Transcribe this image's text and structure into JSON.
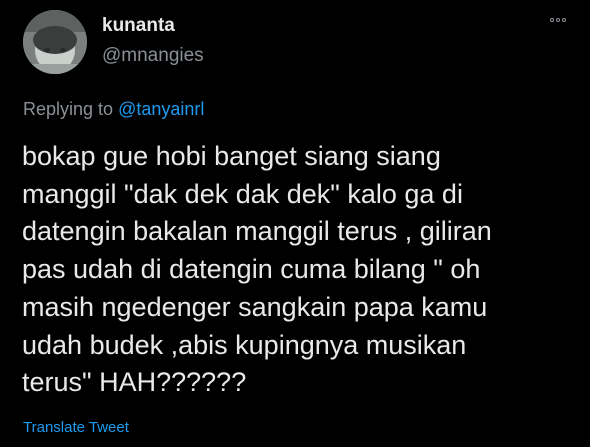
{
  "tweet": {
    "display_name": "kunanta",
    "handle": "@mnangies",
    "replying_prefix": "Replying to ",
    "replying_mention": "@tanyainrl",
    "text": "bokap gue hobi banget siang siang\nmanggil \"dak dek dak dek\" kalo ga di\ndatengin bakalan manggil terus , giliran\npas udah di datengin cuma bilang \" oh\nmasih ngedenger sangkain papa kamu\nudah budek ,abis kupingnya musikan\nterus\" HAH??????",
    "translate_label": "Translate Tweet"
  },
  "icons": {
    "more": "more-options-icon",
    "avatar": "avatar"
  },
  "colors": {
    "background": "#000000",
    "primary_text": "#e7e9ea",
    "secondary_text": "#8b9096",
    "accent": "#1d9bf0"
  }
}
